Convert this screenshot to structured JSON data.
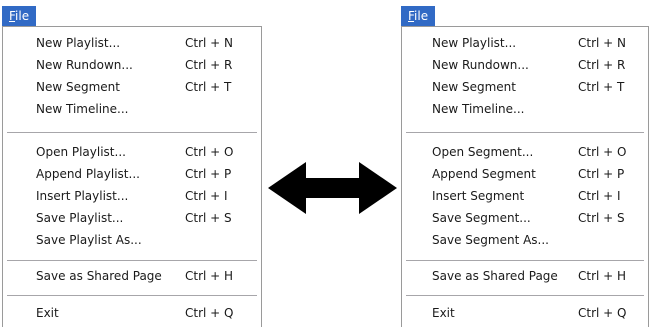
{
  "left_menu": {
    "title_mnemonic": "F",
    "title_rest": "ile",
    "items": [
      {
        "label": "New Playlist...",
        "shortcut": "Ctrl + N"
      },
      {
        "label": "New Rundown...",
        "shortcut": "Ctrl + R"
      },
      {
        "label": "New Segment",
        "shortcut": "Ctrl + T"
      },
      {
        "label": "New Timeline...",
        "shortcut": ""
      },
      {
        "label": "Open Playlist...",
        "shortcut": "Ctrl + O"
      },
      {
        "label": "Append Playlist...",
        "shortcut": "Ctrl + P"
      },
      {
        "label": "Insert Playlist...",
        "shortcut": "Ctrl + I"
      },
      {
        "label": "Save Playlist...",
        "shortcut": "Ctrl + S"
      },
      {
        "label": "Save Playlist As...",
        "shortcut": ""
      },
      {
        "label": "Save as Shared Page",
        "shortcut": "Ctrl + H"
      },
      {
        "label": "Exit",
        "shortcut": "Ctrl + Q"
      }
    ]
  },
  "right_menu": {
    "title_mnemonic": "F",
    "title_rest": "ile",
    "items": [
      {
        "label": "New Playlist...",
        "shortcut": "Ctrl + N"
      },
      {
        "label": "New Rundown...",
        "shortcut": "Ctrl + R"
      },
      {
        "label": "New Segment",
        "shortcut": "Ctrl + T"
      },
      {
        "label": "New Timeline...",
        "shortcut": ""
      },
      {
        "label": "Open Segment...",
        "shortcut": "Ctrl + O"
      },
      {
        "label": "Append Segment",
        "shortcut": "Ctrl + P"
      },
      {
        "label": "Insert Segment",
        "shortcut": "Ctrl + I"
      },
      {
        "label": "Save Segment...",
        "shortcut": "Ctrl + S"
      },
      {
        "label": "Save Segment As...",
        "shortcut": ""
      },
      {
        "label": "Save as Shared Page",
        "shortcut": "Ctrl + H"
      },
      {
        "label": "Exit",
        "shortcut": "Ctrl + Q"
      }
    ]
  },
  "colors": {
    "menu_highlight": "#316ac5",
    "separator": "#a7a6aa",
    "arrow": "#000000"
  },
  "icons": {
    "comparison_arrow": "double-headed-arrow-icon"
  }
}
